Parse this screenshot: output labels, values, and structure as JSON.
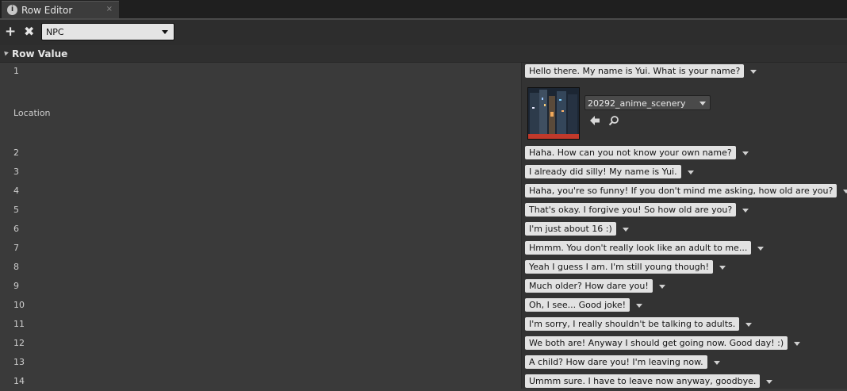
{
  "tab": {
    "title": "Row Editor",
    "icon": "info-icon",
    "close_glyph": "×"
  },
  "toolbar": {
    "add_label": "+",
    "remove_label": "✖",
    "row_name": "NPC"
  },
  "section": {
    "title": "Row Value"
  },
  "rows": [
    {
      "label": "1",
      "value": "Hello there. My name is Yui. What is your name?"
    },
    {
      "label": "2",
      "value": "Haha. How can you not know your own name?"
    },
    {
      "label": "3",
      "value": "I already did silly! My name is Yui."
    },
    {
      "label": "4",
      "value": "Haha, you're so funny! If you don't mind me asking, how old are you?"
    },
    {
      "label": "5",
      "value": "That's okay. I forgive you! So how old are you?"
    },
    {
      "label": "6",
      "value": "I'm just about 16 :)"
    },
    {
      "label": "7",
      "value": "Hmmm. You don't really look like an adult to me..."
    },
    {
      "label": "8",
      "value": "Yeah I guess I am. I'm still young though!"
    },
    {
      "label": "9",
      "value": "Much older? How dare you!"
    },
    {
      "label": "10",
      "value": "Oh, I see... Good joke!"
    },
    {
      "label": "11",
      "value": "I'm sorry, I really shouldn't be talking to adults."
    },
    {
      "label": "12",
      "value": "We both are! Anyway I should get going now. Good day! :)"
    },
    {
      "label": "13",
      "value": "A child? How dare you! I'm leaving now."
    },
    {
      "label": "14",
      "value": "Ummm sure. I have to leave now anyway, goodbye."
    }
  ],
  "location": {
    "label": "Location",
    "asset_name": "20292_anime_scenery"
  },
  "colors": {
    "panel_bg": "#3a3a3a",
    "value_col_bg": "#333333",
    "chip_bg": "#e2e2e2",
    "thumb_accent": "#c0392b"
  }
}
